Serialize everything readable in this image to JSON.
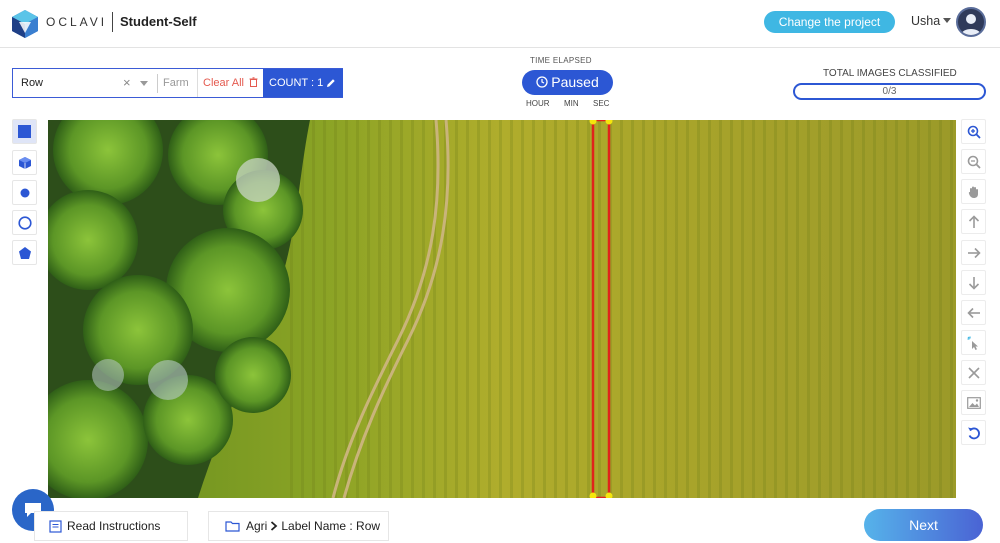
{
  "header": {
    "brand": "OCLAVI",
    "project_name": "Student-Self",
    "change_project_label": "Change the project",
    "user_name": "Usha"
  },
  "label_control": {
    "selected_value": "Row",
    "clear_symbol": "×",
    "secondary_placeholder": "Farm",
    "clear_all_label": "Clear All",
    "count_label": "COUNT : 1"
  },
  "timer": {
    "title": "TIME ELAPSED",
    "status": "Paused",
    "units": [
      "HOUR",
      "MIN",
      "SEC"
    ]
  },
  "classified": {
    "title": "TOTAL IMAGES CLASSIFIED",
    "progress_text": "0/3",
    "progress_fraction": 0
  },
  "left_tools": [
    {
      "name": "rectangle-tool",
      "icon": "square-icon",
      "active": true
    },
    {
      "name": "cuboid-tool",
      "icon": "cube-icon",
      "active": false
    },
    {
      "name": "point-tool",
      "icon": "dot-icon",
      "active": false
    },
    {
      "name": "circle-tool",
      "icon": "circle-icon",
      "active": false
    },
    {
      "name": "polygon-tool",
      "icon": "pentagon-icon",
      "active": false
    }
  ],
  "right_tools": [
    {
      "name": "zoom-in-button",
      "icon": "zoom-in-icon"
    },
    {
      "name": "zoom-out-button",
      "icon": "zoom-out-icon"
    },
    {
      "name": "pan-button",
      "icon": "hand-icon"
    },
    {
      "name": "move-up-button",
      "icon": "arrow-up-icon"
    },
    {
      "name": "move-right-button",
      "icon": "arrow-right-icon"
    },
    {
      "name": "move-down-button",
      "icon": "arrow-down-icon"
    },
    {
      "name": "move-left-button",
      "icon": "arrow-left-icon"
    },
    {
      "name": "select-button",
      "icon": "cursor-click-icon"
    },
    {
      "name": "delete-button",
      "icon": "close-icon"
    },
    {
      "name": "image-button",
      "icon": "image-icon"
    },
    {
      "name": "reset-button",
      "icon": "undo-icon"
    }
  ],
  "footer": {
    "read_instructions_label": "Read Instructions",
    "breadcrumb_folder": "Agri",
    "breadcrumb_label": "Label Name : Row",
    "next_label": "Next"
  },
  "colors": {
    "accent": "#2c57d4",
    "change_project": "#3fb7e3",
    "clear_all": "#e45a4f",
    "annotation_box": "#e0241b",
    "annotation_handle": "#f5e60c"
  }
}
